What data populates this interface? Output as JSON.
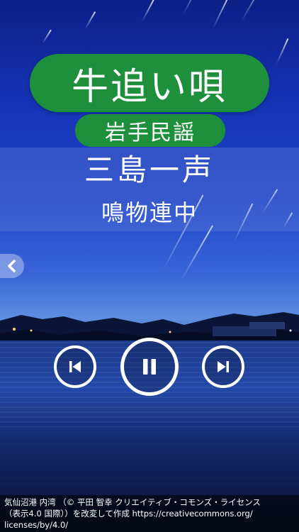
{
  "header": {
    "song_title": "牛追い唄",
    "region_label": "岩手民謡"
  },
  "performer": {
    "singer": "三島一声",
    "accompaniment": "鳴物連中"
  },
  "controls": {
    "back_icon": "chevron-left-icon",
    "prev_icon": "skip-previous-icon",
    "pause_icon": "pause-icon",
    "next_icon": "skip-next-icon"
  },
  "credit": {
    "line1": "気仙沼港 内湾 （© 平田 智幸 クリエイティブ・コモンズ・ライセンス",
    "line2": "（表示4.0 国際））を改変して作成 https://creativecommons.org/",
    "line3": "licenses/by/4.0/"
  },
  "colors": {
    "pill_green": "#1e8f3b",
    "sky_top": "#0b1f86",
    "text": "#ffffff"
  }
}
